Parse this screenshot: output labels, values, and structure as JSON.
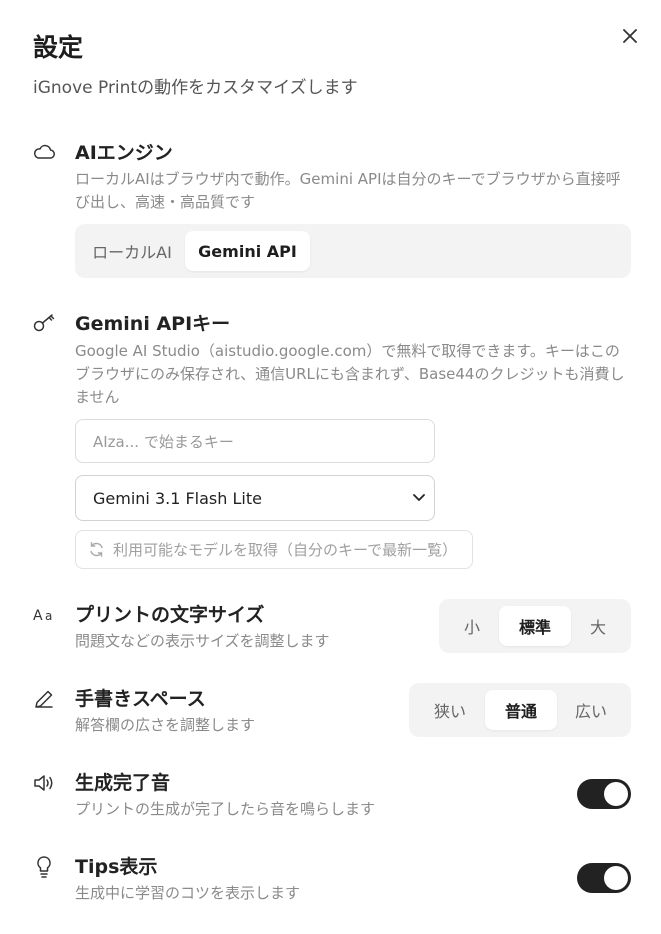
{
  "header": {
    "title": "設定",
    "subtitle": "iGnove Printの動作をカスタマイズします"
  },
  "ai_engine": {
    "title": "AIエンジン",
    "desc": "ローカルAIはブラウザ内で動作。Gemini APIは自分のキーでブラウザから直接呼び出し、高速・高品質です",
    "options": [
      "ローカルAI",
      "Gemini API"
    ],
    "selected": "Gemini API"
  },
  "api_key": {
    "title": "Gemini APIキー",
    "desc": "Google AI Studio（aistudio.google.com）で無料で取得できます。キーはこのブラウザにのみ保存され、通信URLにも含まれず、Base44のクレジットも消費しません",
    "placeholder": "AIza... で始まるキー",
    "model_selected": "Gemini 3.1 Flash Lite",
    "fetch_models_label": "利用可能なモデルを取得（自分のキーで最新一覧）"
  },
  "font_size": {
    "title": "プリントの文字サイズ",
    "desc": "問題文などの表示サイズを調整します",
    "options": [
      "小",
      "標準",
      "大"
    ],
    "selected": "標準"
  },
  "handwriting": {
    "title": "手書きスペース",
    "desc": "解答欄の広さを調整します",
    "options": [
      "狭い",
      "普通",
      "広い"
    ],
    "selected": "普通"
  },
  "sound": {
    "title": "生成完了音",
    "desc": "プリントの生成が完了したら音を鳴らします",
    "enabled": true
  },
  "tips": {
    "title": "Tips表示",
    "desc": "生成中に学習のコツを表示します",
    "enabled": true
  },
  "icons": {
    "close": "close-icon",
    "ai_engine": "cloud-icon",
    "api_key": "key-icon",
    "font_size": "text-size-icon",
    "handwriting": "pencil-icon",
    "sound": "speaker-icon",
    "tips": "lightbulb-icon",
    "refresh": "refresh-icon",
    "chevron": "chevron-down-icon"
  },
  "colors": {
    "toggle_on": "#222222",
    "segment_bg": "#f3f3f3"
  }
}
